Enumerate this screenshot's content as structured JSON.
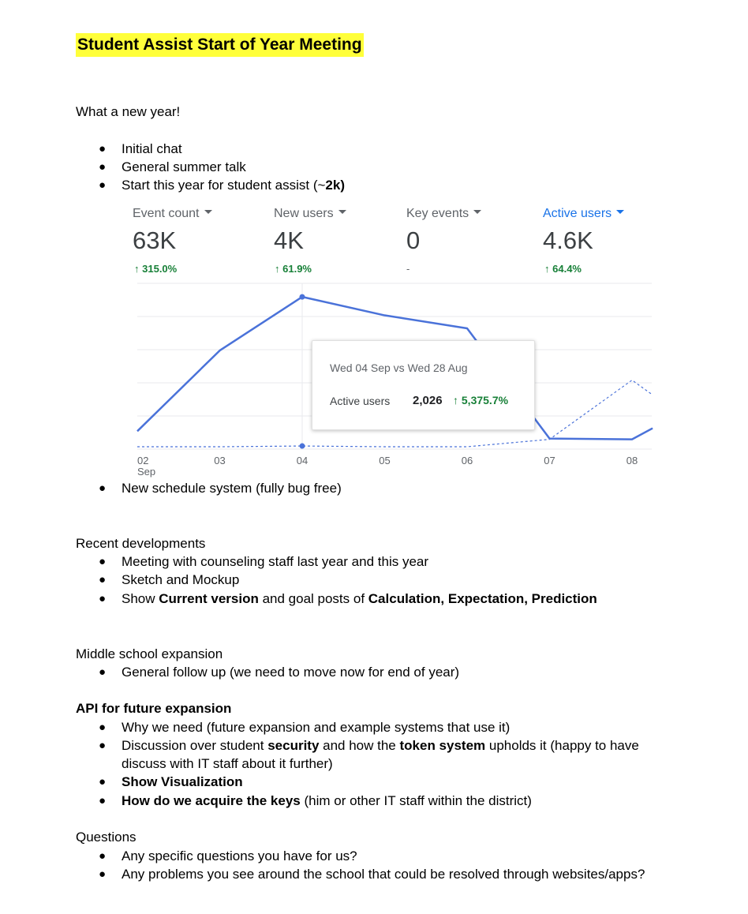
{
  "title": "Student Assist Start of Year Meeting",
  "intro": "What a new year!",
  "intro_bullets": {
    "b1": "Initial chat",
    "b2": "General summer talk",
    "b3_pre": "Start this year for student assist (~",
    "b3_bold": "2k)",
    "b4": "New schedule system (fully bug free)"
  },
  "analytics": {
    "metrics": [
      {
        "label": "Event count",
        "value": "63K",
        "change": "315.0%"
      },
      {
        "label": "New users",
        "value": "4K",
        "change": "61.9%"
      },
      {
        "label": "Key events",
        "value": "0",
        "change": "-"
      },
      {
        "label": "Active users",
        "value": "4.6K",
        "change": "64.4%",
        "active": true
      }
    ],
    "colors": {
      "accent": "#1a73e8",
      "line": "#4a72d9",
      "positive": "#188038",
      "grid": "#e8eaed"
    },
    "tooltip": {
      "date": "Wed 04 Sep vs Wed 28 Aug",
      "metric": "Active users",
      "value": "2,026",
      "change": "5,375.7%"
    }
  },
  "chart_data": {
    "type": "line",
    "title": "",
    "xlabel": "",
    "ylabel": "",
    "categories": [
      "02 Sep",
      "03",
      "04",
      "05",
      "06",
      "07",
      "08"
    ],
    "x_month_label": "Sep",
    "series": [
      {
        "name": "",
        "style": "solid",
        "values": [
          0.42,
          2.6,
          4.05,
          3.55,
          3.2,
          0.22,
          0.2
        ]
      },
      {
        "name": "",
        "style": "dashed",
        "values": [
          0,
          0,
          0.02,
          0,
          0,
          0.2,
          1.8
        ]
      }
    ],
    "tail_point": {
      "x": 8.25,
      "solid": 0.5,
      "dashed": 1.4
    },
    "ylim": [
      0,
      4.5
    ],
    "grid": true,
    "legend": "none"
  },
  "recent": {
    "heading": "Recent developments",
    "b1": "Meeting with counseling staff last year and this year",
    "b2": "Sketch and Mockup",
    "b3_pre": "Show ",
    "b3_bold1": "Current version",
    "b3_mid": " and goal posts of ",
    "b3_bold2": "Calculation, Expectation, Prediction"
  },
  "middle": {
    "heading": "Middle school expansion",
    "b1": "General follow up (we need to move now for end of year)"
  },
  "api": {
    "heading": "API for future expansion",
    "b1": "Why we need (future expansion and example systems that use it)",
    "b2_pre": "Discussion over student ",
    "b2_bold1": "security",
    "b2_mid": " and how the ",
    "b2_bold2": "token system",
    "b2_post": " upholds it (happy to have",
    "b2_cont": "discuss with IT staff about it further)",
    "b3": "Show Visualization",
    "b4_bold": "How do we acquire the keys",
    "b4_post": " (him or other IT staff within the district)"
  },
  "questions": {
    "heading": "Questions",
    "b1": "Any specific questions you have for us?",
    "b2": "Any problems you see around the school that could be resolved through websites/apps?"
  },
  "bullet_glyph": "●"
}
